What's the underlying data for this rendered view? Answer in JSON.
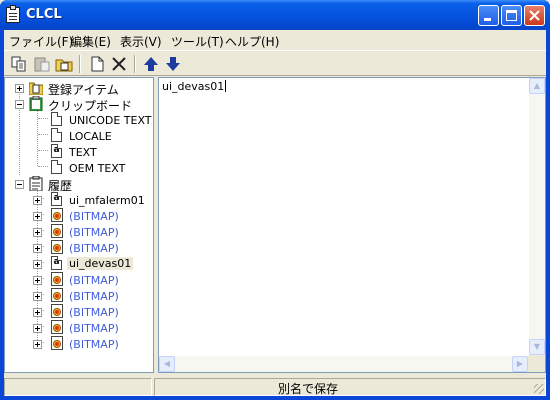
{
  "window": {
    "title": "CLCL"
  },
  "menubar": [
    "ファイル(F)",
    "編集(E)",
    "表示(V)",
    "ツール(T)",
    "ヘルプ(H)"
  ],
  "toolbar": {
    "icons": [
      "copy-icon",
      "paste-icon",
      "folder-icon",
      "new-icon",
      "delete-icon",
      "move-up-icon",
      "move-down-icon"
    ]
  },
  "tree": {
    "registered": "登録アイテム",
    "clipboard": "クリップボード",
    "formats": [
      "UNICODE TEXT",
      "LOCALE",
      "TEXT",
      "OEM TEXT"
    ],
    "history_label": "履歴",
    "history": [
      "ui_mfalerm01",
      "(BITMAP)",
      "(BITMAP)",
      "(BITMAP)",
      "ui_devas01",
      "(BITMAP)",
      "(BITMAP)",
      "(BITMAP)",
      "(BITMAP)",
      "(BITMAP)"
    ]
  },
  "editor": {
    "content": "ui_devas01"
  },
  "statusbar": {
    "left": "",
    "right": "別名で保存"
  },
  "colors": {
    "titlebar": "#0654e0",
    "bitmap_text": "#3f5fd8",
    "face": "#ece9d8"
  }
}
